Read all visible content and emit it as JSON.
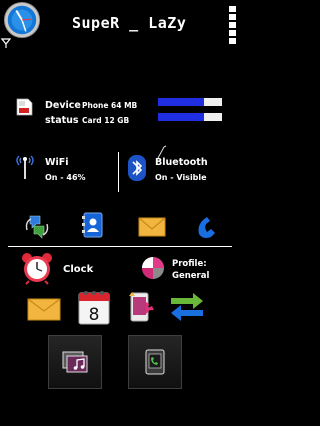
{
  "header": {
    "title": "SupeR _ LaZy"
  },
  "device_status": {
    "label_line1": "Device",
    "label_line2": "status",
    "phone_memory": "Phone 64 MB",
    "card_memory": "Card 12 GB",
    "phone_used_fraction": 0.72,
    "card_used_fraction": 0.72
  },
  "wifi": {
    "label": "WiFi",
    "status": "On - 46%"
  },
  "bluetooth": {
    "label": "Bluetooth",
    "status": "On - Visible"
  },
  "clock_app": {
    "label": "Clock"
  },
  "profile": {
    "label": "Profile:",
    "value": "General"
  },
  "calendar": {
    "day": "8"
  },
  "colors": {
    "accent_blue": "#1f2ee0",
    "bar_free": "#f0f0f0",
    "background": "#000000"
  }
}
